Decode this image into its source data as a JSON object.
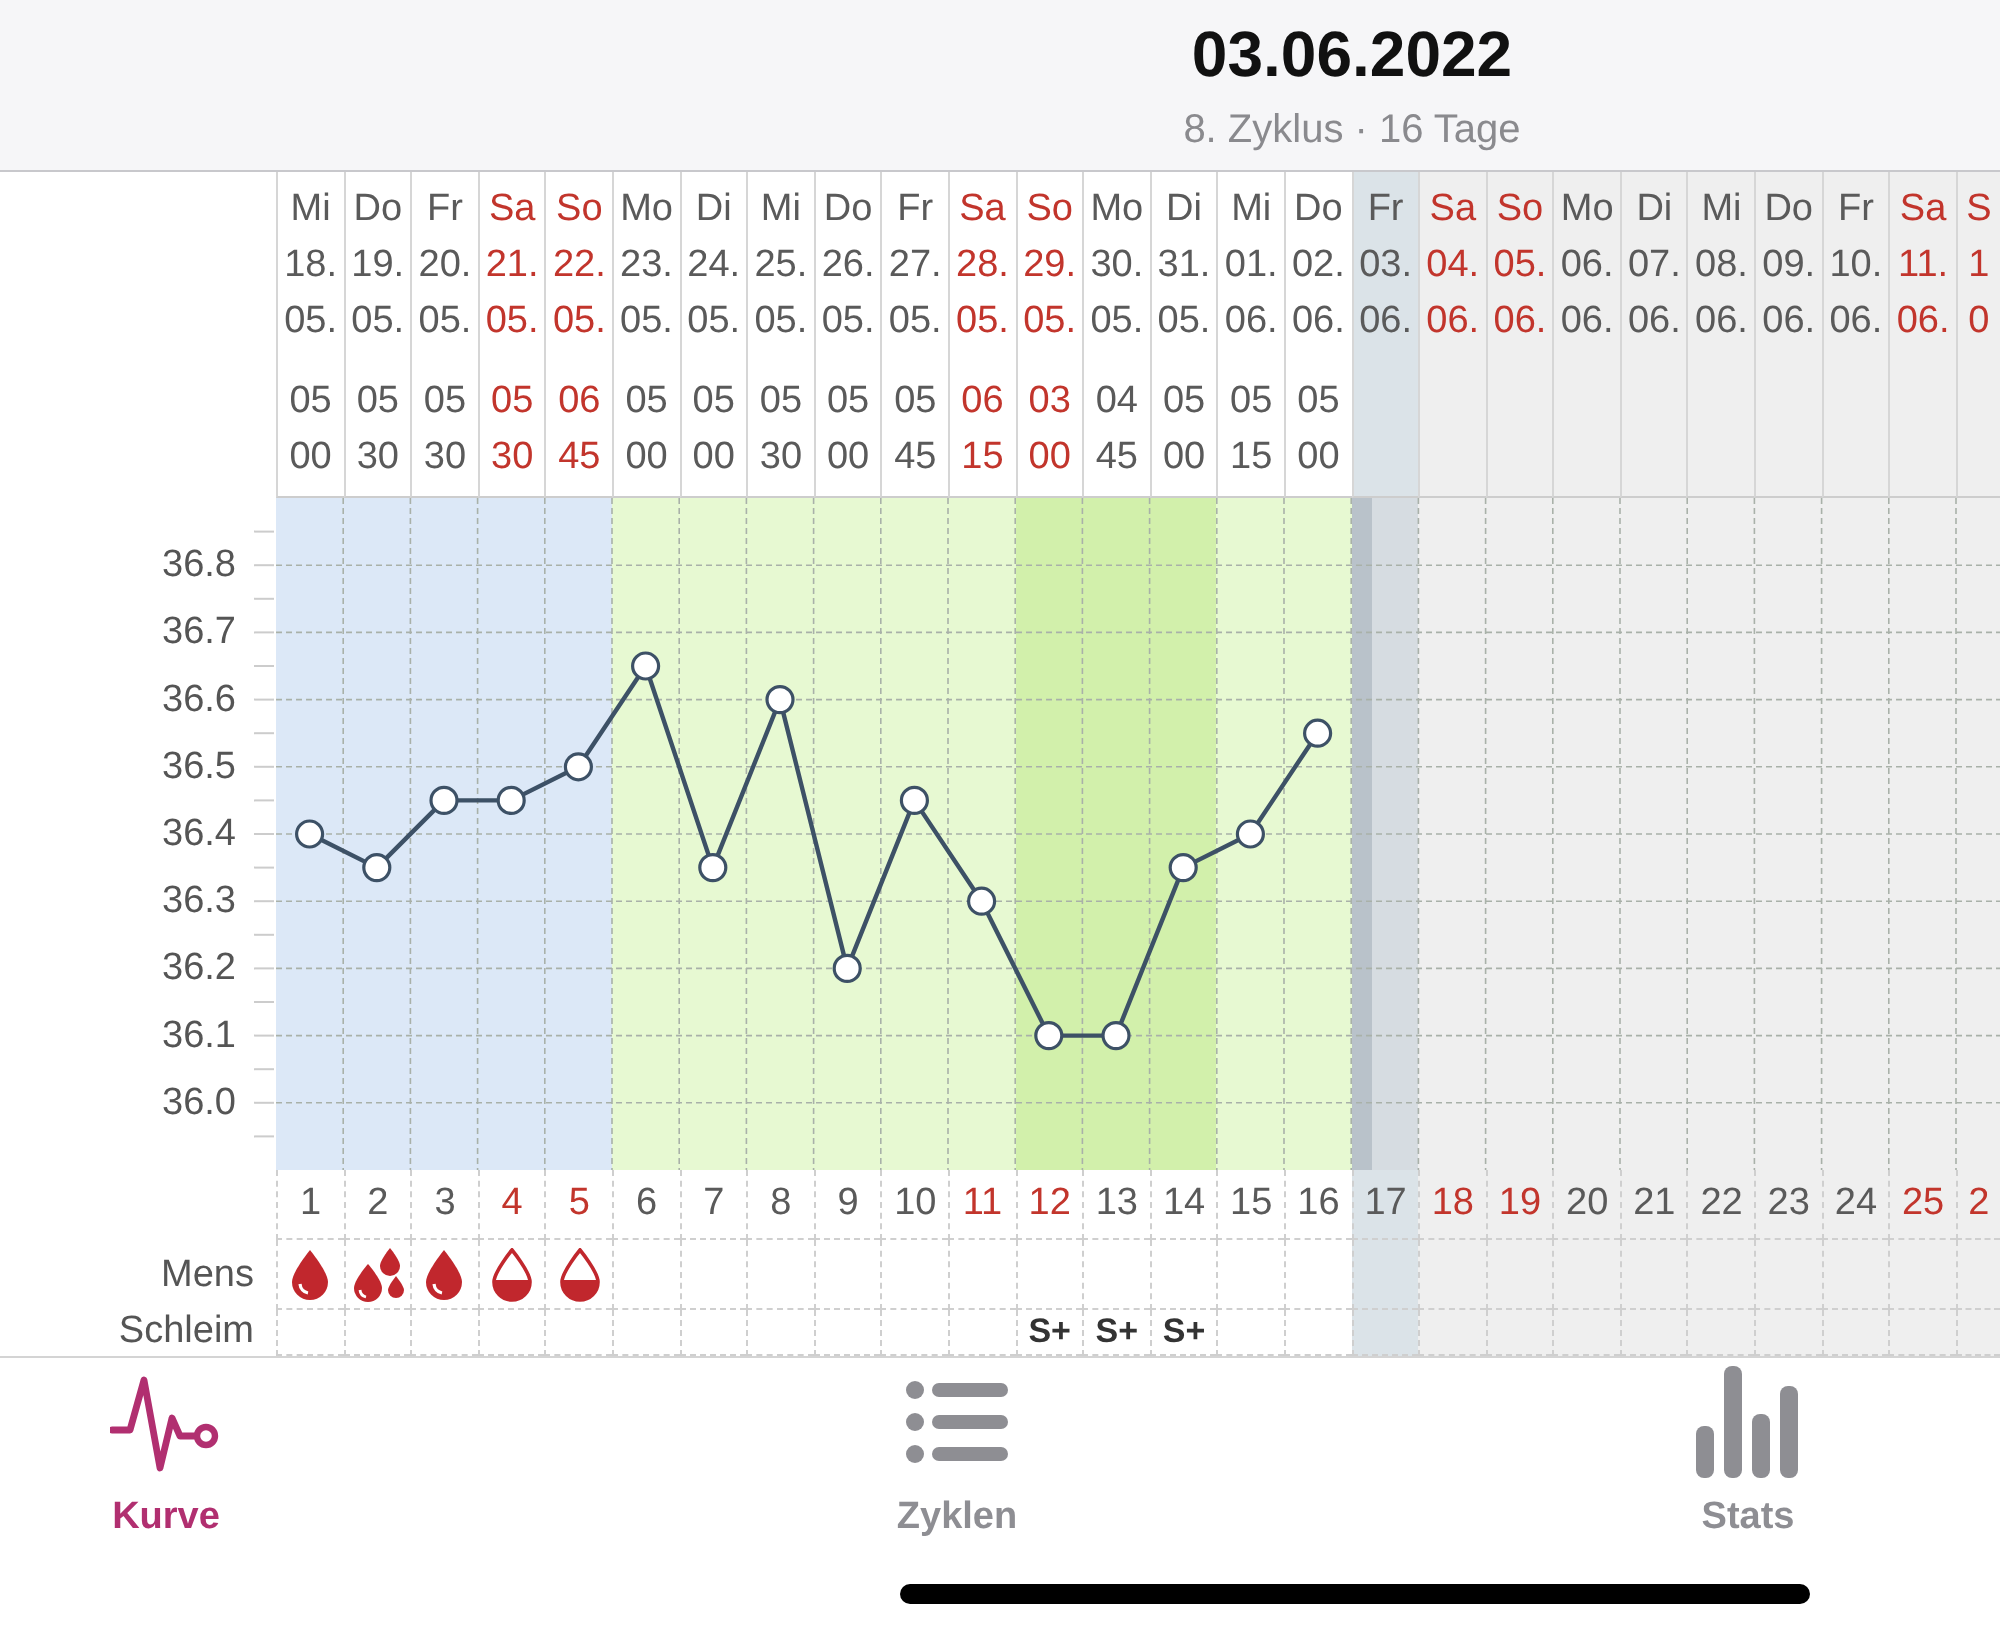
{
  "header": {
    "title": "03.06.2022",
    "subtitle": "8. Zyklus · 16 Tage"
  },
  "days": [
    {
      "weekday": "Mi",
      "day_of_month": "18.",
      "month": "05.",
      "time_hour": "05",
      "time_minute": "00",
      "cycle_day": "1",
      "weekend": false,
      "kind": "menstruation",
      "selected": false,
      "mens": {
        "kind": "medium"
      }
    },
    {
      "weekday": "Do",
      "day_of_month": "19.",
      "month": "05.",
      "time_hour": "05",
      "time_minute": "30",
      "cycle_day": "2",
      "weekend": false,
      "kind": "menstruation",
      "selected": false,
      "mens": {
        "kind": "heavy"
      }
    },
    {
      "weekday": "Fr",
      "day_of_month": "20.",
      "month": "05.",
      "time_hour": "05",
      "time_minute": "30",
      "cycle_day": "3",
      "weekend": false,
      "kind": "menstruation",
      "selected": false,
      "mens": {
        "kind": "medium"
      }
    },
    {
      "weekday": "Sa",
      "day_of_month": "21.",
      "month": "05.",
      "time_hour": "05",
      "time_minute": "30",
      "cycle_day": "4",
      "weekend": true,
      "kind": "menstruation",
      "selected": false,
      "mens": {
        "kind": "light"
      }
    },
    {
      "weekday": "So",
      "day_of_month": "22.",
      "month": "05.",
      "time_hour": "06",
      "time_minute": "45",
      "cycle_day": "5",
      "weekend": true,
      "kind": "menstruation",
      "selected": false,
      "mens": {
        "kind": "light"
      }
    },
    {
      "weekday": "Mo",
      "day_of_month": "23.",
      "month": "05.",
      "time_hour": "05",
      "time_minute": "00",
      "cycle_day": "6",
      "weekend": false,
      "kind": "fertile",
      "selected": false
    },
    {
      "weekday": "Di",
      "day_of_month": "24.",
      "month": "05.",
      "time_hour": "05",
      "time_minute": "00",
      "cycle_day": "7",
      "weekend": false,
      "kind": "fertile",
      "selected": false
    },
    {
      "weekday": "Mi",
      "day_of_month": "25.",
      "month": "05.",
      "time_hour": "05",
      "time_minute": "30",
      "cycle_day": "8",
      "weekend": false,
      "kind": "fertile",
      "selected": false
    },
    {
      "weekday": "Do",
      "day_of_month": "26.",
      "month": "05.",
      "time_hour": "05",
      "time_minute": "00",
      "cycle_day": "9",
      "weekend": false,
      "kind": "fertile",
      "selected": false
    },
    {
      "weekday": "Fr",
      "day_of_month": "27.",
      "month": "05.",
      "time_hour": "05",
      "time_minute": "45",
      "cycle_day": "10",
      "weekend": false,
      "kind": "fertile",
      "selected": false
    },
    {
      "weekday": "Sa",
      "day_of_month": "28.",
      "month": "05.",
      "time_hour": "06",
      "time_minute": "15",
      "cycle_day": "11",
      "weekend": true,
      "kind": "fertile",
      "selected": false
    },
    {
      "weekday": "So",
      "day_of_month": "29.",
      "month": "05.",
      "time_hour": "03",
      "time_minute": "00",
      "cycle_day": "12",
      "weekend": true,
      "kind": "peak",
      "selected": false,
      "mucus": "S+"
    },
    {
      "weekday": "Mo",
      "day_of_month": "30.",
      "month": "05.",
      "time_hour": "04",
      "time_minute": "45",
      "cycle_day": "13",
      "weekend": false,
      "kind": "peak",
      "selected": false,
      "mucus": "S+"
    },
    {
      "weekday": "Di",
      "day_of_month": "31.",
      "month": "05.",
      "time_hour": "05",
      "time_minute": "00",
      "cycle_day": "14",
      "weekend": false,
      "kind": "peak",
      "selected": false,
      "mucus": "S+"
    },
    {
      "weekday": "Mi",
      "day_of_month": "01.",
      "month": "06.",
      "time_hour": "05",
      "time_minute": "15",
      "cycle_day": "15",
      "weekend": false,
      "kind": "fertile",
      "selected": false
    },
    {
      "weekday": "Do",
      "day_of_month": "02.",
      "month": "06.",
      "time_hour": "05",
      "time_minute": "00",
      "cycle_day": "16",
      "weekend": false,
      "kind": "fertile",
      "selected": false
    },
    {
      "weekday": "Fr",
      "day_of_month": "03.",
      "month": "06.",
      "cycle_day": "17",
      "weekend": false,
      "kind": "future",
      "selected": true
    },
    {
      "weekday": "Sa",
      "day_of_month": "04.",
      "month": "06.",
      "cycle_day": "18",
      "weekend": true,
      "kind": "future",
      "selected": false
    },
    {
      "weekday": "So",
      "day_of_month": "05.",
      "month": "06.",
      "cycle_day": "19",
      "weekend": true,
      "kind": "future",
      "selected": false
    },
    {
      "weekday": "Mo",
      "day_of_month": "06.",
      "month": "06.",
      "cycle_day": "20",
      "weekend": false,
      "kind": "future",
      "selected": false
    },
    {
      "weekday": "Di",
      "day_of_month": "07.",
      "month": "06.",
      "cycle_day": "21",
      "weekend": false,
      "kind": "future",
      "selected": false
    },
    {
      "weekday": "Mi",
      "day_of_month": "08.",
      "month": "06.",
      "cycle_day": "22",
      "weekend": false,
      "kind": "future",
      "selected": false
    },
    {
      "weekday": "Do",
      "day_of_month": "09.",
      "month": "06.",
      "cycle_day": "23",
      "weekend": false,
      "kind": "future",
      "selected": false
    },
    {
      "weekday": "Fr",
      "day_of_month": "10.",
      "month": "06.",
      "cycle_day": "24",
      "weekend": false,
      "kind": "future",
      "selected": false
    },
    {
      "weekday": "Sa",
      "day_of_month": "11.",
      "month": "06.",
      "cycle_day": "25",
      "weekend": true,
      "kind": "future",
      "selected": false
    },
    {
      "weekday": "S",
      "day_of_month": "1",
      "month": "0",
      "cycle_day": "2",
      "weekend": true,
      "kind": "future",
      "selected": false
    }
  ],
  "chart_data": {
    "type": "line",
    "grid": true,
    "ylim": [
      35.9,
      36.9
    ],
    "yticks": [
      {
        "value": 36.0,
        "label": "36.0"
      },
      {
        "value": 36.1,
        "label": "36.1"
      },
      {
        "value": 36.2,
        "label": "36.2"
      },
      {
        "value": 36.3,
        "label": "36.3"
      },
      {
        "value": 36.4,
        "label": "36.4"
      },
      {
        "value": 36.5,
        "label": "36.5"
      },
      {
        "value": 36.6,
        "label": "36.6"
      },
      {
        "value": 36.7,
        "label": "36.7"
      },
      {
        "value": 36.8,
        "label": "36.8"
      }
    ],
    "series": [
      {
        "color": "#3d5166",
        "marker": "o",
        "values": [
          36.4,
          36.35,
          36.45,
          36.45,
          36.5,
          36.65,
          36.35,
          36.6,
          36.2,
          36.45,
          36.3,
          36.1,
          36.1,
          36.35,
          36.4,
          36.55,
          null,
          null,
          null,
          null,
          null,
          null,
          null,
          null,
          null,
          null
        ]
      }
    ]
  },
  "rows": {
    "mens_label": "Mens",
    "mucus_label": "Schleim"
  },
  "tabs": [
    {
      "label": "Kurve",
      "selected": true
    },
    {
      "label": "Zyklen",
      "selected": false
    },
    {
      "label": "Stats",
      "selected": false
    }
  ]
}
